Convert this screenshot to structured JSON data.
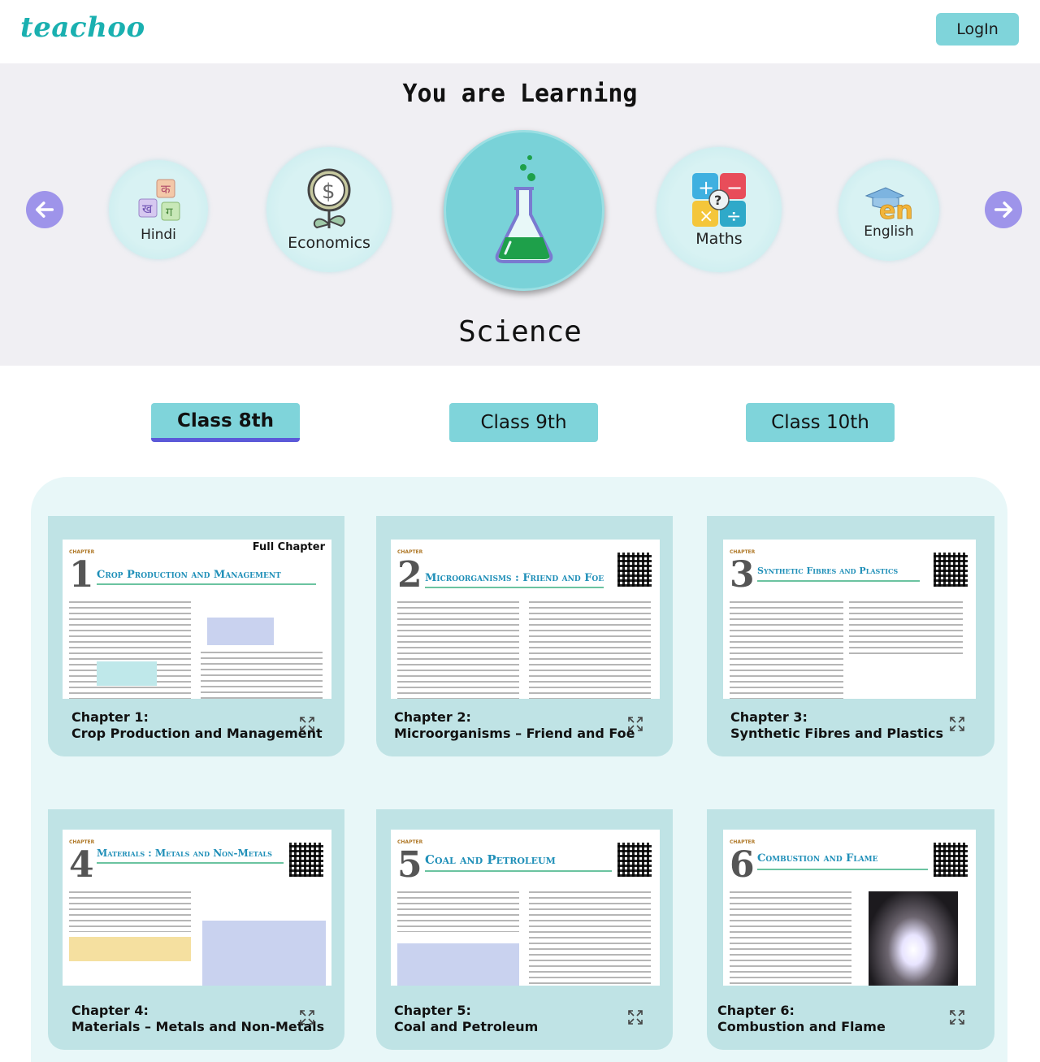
{
  "header": {
    "logo": "teachoo",
    "login_label": "LogIn"
  },
  "learning": {
    "heading": "You are Learning",
    "current_subject": "Science",
    "subjects": [
      {
        "label": "Hindi",
        "icon": "hindi-letters-icon"
      },
      {
        "label": "Economics",
        "icon": "money-plant-icon"
      },
      {
        "label": "",
        "icon": "flask-icon"
      },
      {
        "label": "Maths",
        "icon": "math-operators-icon"
      },
      {
        "label": "English",
        "icon": "english-en-icon"
      }
    ]
  },
  "classes": [
    {
      "label": "Class 8th",
      "active": true
    },
    {
      "label": "Class 9th",
      "active": false
    },
    {
      "label": "Class 10th",
      "active": false
    }
  ],
  "chapters": [
    {
      "number_label": "Chapter 1:",
      "title": "Crop Production and Management",
      "page_title": "Crop Production and Management",
      "badge": "Full Chapter",
      "num": "1"
    },
    {
      "number_label": "Chapter 2:",
      "title": "Microorganisms – Friend and Foe",
      "page_title": "Microorganisms : Friend and Foe",
      "num": "2"
    },
    {
      "number_label": "Chapter 3:",
      "title": "Synthetic Fibres and Plastics",
      "page_title": "Synthetic Fibres and Plastics",
      "num": "3"
    },
    {
      "number_label": "Chapter 4:",
      "title": "Materials – Metals and Non-Metals",
      "page_title": "Materials : Metals and Non-Metals",
      "num": "4"
    },
    {
      "number_label": "Chapter 5:",
      "title": "Coal and Petroleum",
      "page_title": "Coal and Petroleum",
      "num": "5"
    },
    {
      "number_label": "Chapter 6:",
      "title": "Combustion and Flame",
      "page_title": "Combustion and Flame",
      "num": "6"
    }
  ],
  "colors": {
    "brand": "#1ab0b0",
    "accent": "#7fd4da",
    "active_underline": "#5b59d8",
    "arrow": "#9e94ea"
  }
}
